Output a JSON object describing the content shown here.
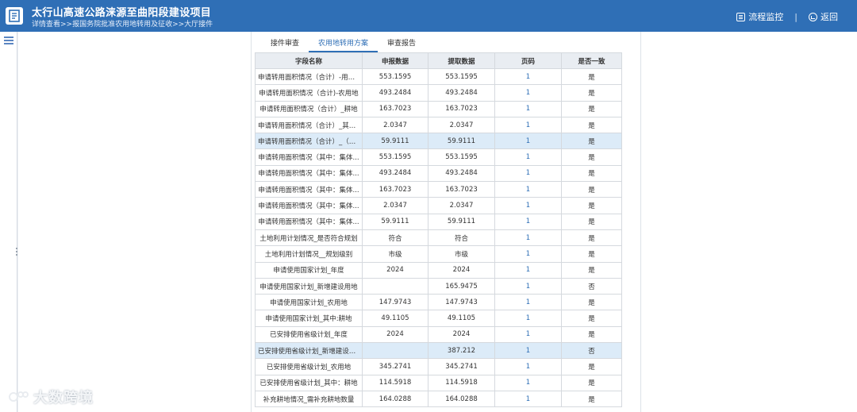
{
  "header": {
    "title": "太行山高速公路涞源至曲阳段建设项目",
    "breadcrumb": "详情查看>>报国务院批准农用地转用及征收>>大厅接件",
    "actions": {
      "process_monitor": "流程监控",
      "separator": "|",
      "back": "返回"
    }
  },
  "tabs": [
    {
      "label": "接件审查",
      "active": false
    },
    {
      "label": "农用地转用方案",
      "active": true
    },
    {
      "label": "审查报告",
      "active": false
    }
  ],
  "table": {
    "headers": [
      "字段名称",
      "申报数据",
      "提取数据",
      "页码",
      "是否一致"
    ],
    "rows": [
      [
        "申请转用面积情况（合计）-用地...",
        "553.1595",
        "553.1595",
        "1",
        "是"
      ],
      [
        "申请转用面积情况（合计)-农用地",
        "493.2484",
        "493.2484",
        "1",
        "是"
      ],
      [
        "申请转用面积情况（合计）_耕地",
        "163.7023",
        "163.7023",
        "1",
        "是"
      ],
      [
        "申请转用面积情况（合计）_其中...",
        "2.0347",
        "2.0347",
        "1",
        "是"
      ],
      [
        "申请转用面积情况（合计）_（二...",
        "59.9111",
        "59.9111",
        "1",
        "是"
      ],
      [
        "申请转用面积情况（其中：集体...",
        "553.1595",
        "553.1595",
        "1",
        "是"
      ],
      [
        "申请转用面积情况（其中：集体...",
        "493.2484",
        "493.2484",
        "1",
        "是"
      ],
      [
        "申请转用面积情况（其中：集体...",
        "163.7023",
        "163.7023",
        "1",
        "是"
      ],
      [
        "申请转用面积情况（其中：集体...",
        "2.0347",
        "2.0347",
        "1",
        "是"
      ],
      [
        "申请转用面积情况（其中：集体...",
        "59.9111",
        "59.9111",
        "1",
        "是"
      ],
      [
        "土地利用计划情况_是否符合规划",
        "符合",
        "符合",
        "1",
        "是"
      ],
      [
        "土地利用计划情况__规划级别",
        "市级",
        "市级",
        "1",
        "是"
      ],
      [
        "申请使用国家计划_年度",
        "2024",
        "2024",
        "1",
        "是"
      ],
      [
        "申请使用国家计划_新增建设用地",
        "",
        "165.9475",
        "1",
        "否"
      ],
      [
        "申请使用国家计划_农用地",
        "147.9743",
        "147.9743",
        "1",
        "是"
      ],
      [
        "申请使用国家计划_其中:耕地",
        "49.1105",
        "49.1105",
        "1",
        "是"
      ],
      [
        "已安排使用省级计划_年度",
        "2024",
        "2024",
        "1",
        "是"
      ],
      [
        "已安排使用省级计划_新增建设用...",
        "",
        "387.212",
        "1",
        "否"
      ],
      [
        "已安排使用省级计划_农用地",
        "345.2741",
        "345.2741",
        "1",
        "是"
      ],
      [
        "已安排使用省级计划_其中：耕地",
        "114.5918",
        "114.5918",
        "1",
        "是"
      ],
      [
        "补充耕地情况_需补充耕地数量",
        "164.0288",
        "164.0288",
        "1",
        "是"
      ]
    ],
    "highlighted_rows": [
      4,
      17
    ]
  },
  "watermark": {
    "text": "大数跨境"
  },
  "colors": {
    "header_bg": "#2f6fb6",
    "accent": "#2f6fb6",
    "row_highlight": "#dcebf8"
  },
  "icons": {
    "logo": "document-icon",
    "process_monitor": "monitor-icon",
    "back": "back-icon",
    "menu": "menu-icon"
  }
}
